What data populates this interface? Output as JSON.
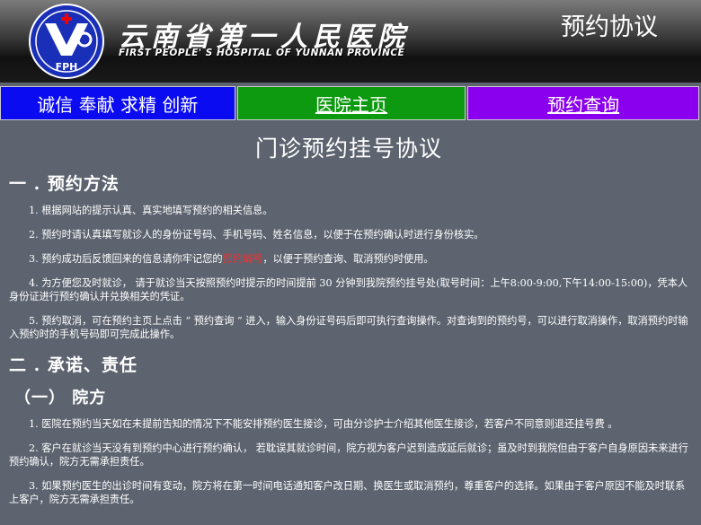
{
  "header": {
    "logo_text": "FPH",
    "hospital_name_cn": "云南省第一人民医院",
    "hospital_name_en": "FIRST PEOPLE' S HOSPITAL OF YUNNAN PROVINCE",
    "page_title": "预约协议"
  },
  "nav": {
    "slogan": "诚信 奉献 求精 创新",
    "home_link": "医院主页",
    "query_link": "预约查询"
  },
  "colors": {
    "slogan_bg": "#0b0bf2",
    "home_bg": "#0d9a10",
    "query_bg": "#8a00ee",
    "page_bg": "#5d6470",
    "highlight": "#ff2a2a"
  },
  "doc": {
    "title": "门诊预约挂号协议",
    "section1": {
      "heading": "一 . 预约方法",
      "item1": "1. 根据网站的提示认真、真实地填写预约的相关信息。",
      "item2": "2. 预约时请认真填写就诊人的身份证号码、手机号码、姓名信息，以便于在预约确认时进行身份核实。",
      "item3_before": "3. 预约成功后反馈回来的信息请你牢记您的",
      "item3_highlight": "预约编号",
      "item3_after": "，以便于预约查询、取消预约时使用。",
      "item4": "4. 为方便您及时就诊， 请于就诊当天按照预约时提示的时间提前 30 分钟到我院预约挂号处(取号时间：上午8:00-9:00,下午14:00-15:00)，凭本人身份证进行预约确认并兑换相关的凭证。",
      "item5": "5. 预约取消，可在预约主页上点击 “ 预约查询 ” 进入，输入身份证号码后即可执行查询操作。对查询到的预约号，可以进行取消操作，取消预约时输入预约时的手机号码即可完成此操作。"
    },
    "section2": {
      "heading": "二 . 承诺、责任",
      "sub1": "（一）  院方",
      "item1": "1. 医院在预约当天如在未提前告知的情况下不能安排预约医生接诊，可由分诊护士介绍其他医生接诊，若客户不同意则退还挂号费 。",
      "item2": "2. 客户在就诊当天没有到预约中心进行预约确认， 若耽误其就诊时间，院方视为客户迟到造成延后就诊；虽及时到我院但由于客户自身原因未来进行预约确认，院方无需承担责任。",
      "item3": "3. 如果预约医生的出诊时间有变动，院方将在第一时间电话通知客户改日期、换医生或取消预约，尊重客户的选择。如果由于客户原因不能及时联系上客户，院方无需承担责任。"
    }
  }
}
